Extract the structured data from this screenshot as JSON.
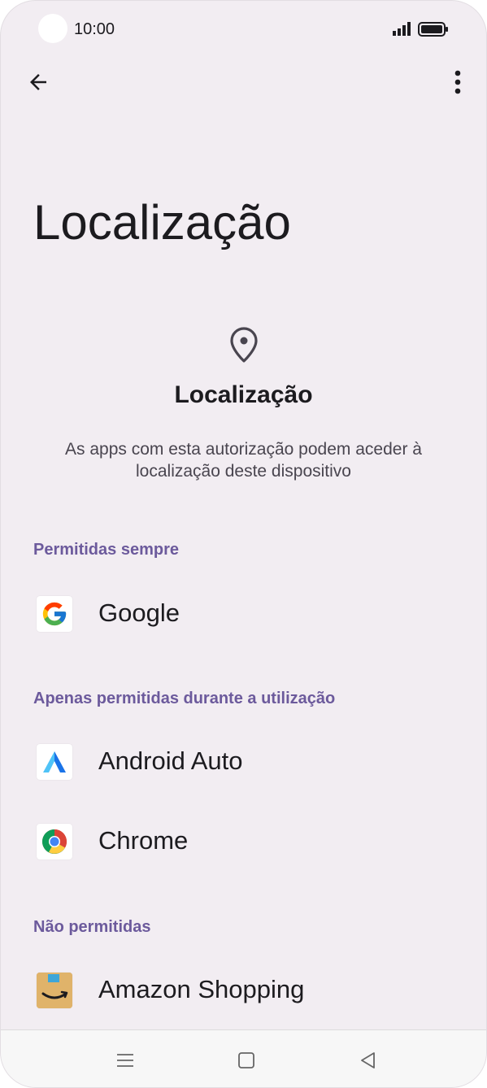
{
  "status_bar": {
    "time": "10:00"
  },
  "page": {
    "title": "Localização"
  },
  "permission": {
    "icon": "location-pin-icon",
    "title": "Localização",
    "description": "As apps com esta autorização podem aceder à localização deste dispositivo"
  },
  "sections": [
    {
      "header": "Permitidas sempre",
      "apps": [
        {
          "name": "Google",
          "icon": "google-icon"
        }
      ]
    },
    {
      "header": "Apenas permitidas durante a utilização",
      "apps": [
        {
          "name": "Android Auto",
          "icon": "android-auto-icon"
        },
        {
          "name": "Chrome",
          "icon": "chrome-icon"
        }
      ]
    },
    {
      "header": "Não permitidas",
      "apps": [
        {
          "name": "Amazon Shopping",
          "icon": "amazon-shopping-icon"
        }
      ]
    }
  ],
  "colors": {
    "background": "#f2edf2",
    "section_header": "#6c5a9c",
    "text_primary": "#1c1b1f",
    "text_secondary": "#49454f"
  }
}
